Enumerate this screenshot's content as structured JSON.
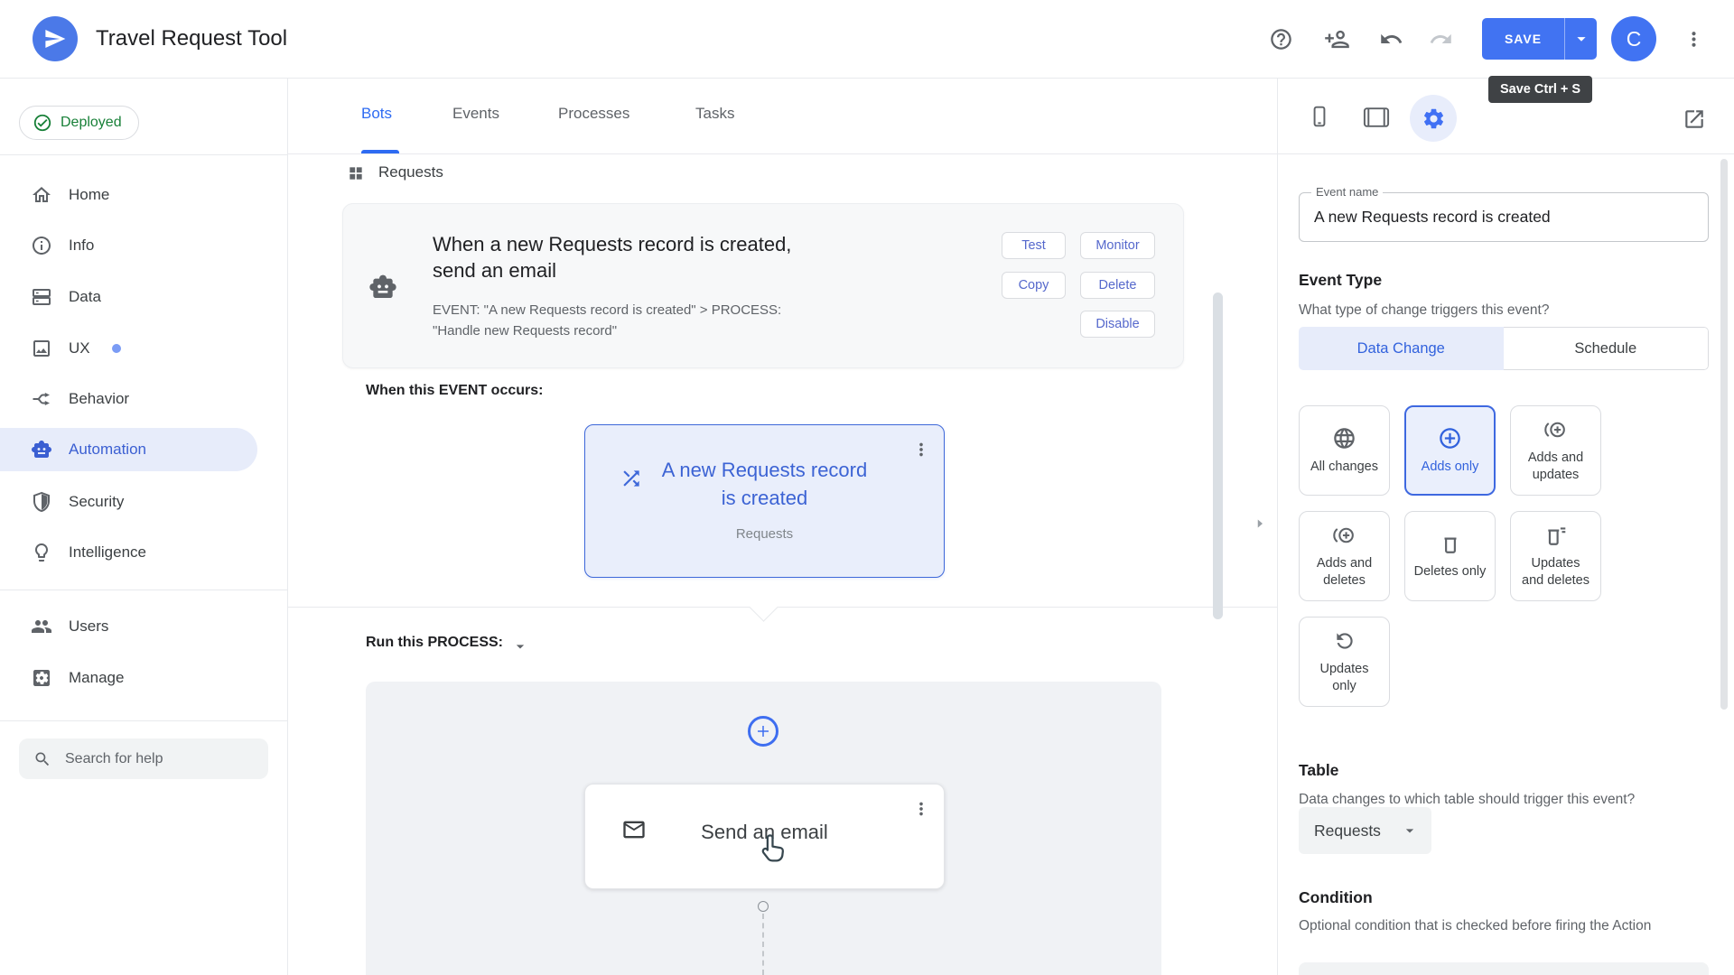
{
  "header": {
    "app_title": "Travel Request Tool",
    "save_button": "SAVE",
    "save_tooltip": "Save Ctrl + S",
    "avatar_initial": "C"
  },
  "sidebar": {
    "status_badge": "Deployed",
    "nav_items": [
      {
        "label": "Home"
      },
      {
        "label": "Info"
      },
      {
        "label": "Data"
      },
      {
        "label": "UX"
      },
      {
        "label": "Behavior"
      },
      {
        "label": "Automation"
      },
      {
        "label": "Security"
      },
      {
        "label": "Intelligence"
      },
      {
        "label": "Users"
      },
      {
        "label": "Manage"
      }
    ],
    "active_item": "Automation",
    "search_placeholder": "Search for help"
  },
  "main": {
    "tabs": [
      {
        "label": "Bots"
      },
      {
        "label": "Events"
      },
      {
        "label": "Processes"
      },
      {
        "label": "Tasks"
      }
    ],
    "active_tab": "Bots",
    "breadcrumb": "Requests",
    "bot_card": {
      "title": "When a new Requests record is created, send an email",
      "subtitle": "EVENT: \"A new Requests record is created\" > PROCESS: \"Handle new Requests record\"",
      "actions": {
        "test": "Test",
        "monitor": "Monitor",
        "copy": "Copy",
        "delete": "Delete",
        "disable": "Disable"
      }
    },
    "event_section_label": "When this EVENT occurs:",
    "event_node": {
      "title": "A new Requests record is created",
      "table": "Requests"
    },
    "process_section_label": "Run this PROCESS:",
    "process_node": {
      "title": "Send an email"
    }
  },
  "panel": {
    "event_name_field": {
      "label": "Event name",
      "value": "A new Requests record is created"
    },
    "event_type": {
      "heading": "Event Type",
      "question": "What type of change triggers this event?",
      "segments": [
        {
          "label": "Data Change"
        },
        {
          "label": "Schedule"
        }
      ],
      "active_segment": "Data Change",
      "options": [
        {
          "label": "All changes"
        },
        {
          "label": "Adds only"
        },
        {
          "label": "Adds and updates"
        },
        {
          "label": "Adds and deletes"
        },
        {
          "label": "Deletes only"
        },
        {
          "label": "Updates and deletes"
        },
        {
          "label": "Updates only"
        }
      ],
      "selected_option": "Adds only"
    },
    "table_section": {
      "heading": "Table",
      "question": "Data changes to which table should trigger this event?",
      "selected_table": "Requests"
    },
    "condition_section": {
      "heading": "Condition",
      "description": "Optional condition that is checked before firing the Action"
    }
  },
  "colors": {
    "accent": "#4173f2",
    "accent_text": "#3b63d8",
    "accent_bg": "#e8edfb",
    "deployed_green": "#188038",
    "tooltip_bg": "#3f4245"
  }
}
